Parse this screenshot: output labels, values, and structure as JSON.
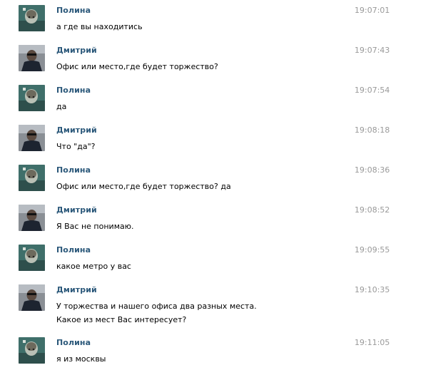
{
  "messages": [
    {
      "author": "Полина",
      "time": "19:07:01",
      "avatar": "polina",
      "lines": [
        "а где вы находитись"
      ]
    },
    {
      "author": "Дмитрий",
      "time": "19:07:43",
      "avatar": "dmitriy",
      "lines": [
        "Офис или место,где будет торжество?"
      ]
    },
    {
      "author": "Полина",
      "time": "19:07:54",
      "avatar": "polina",
      "lines": [
        "да"
      ]
    },
    {
      "author": "Дмитрий",
      "time": "19:08:18",
      "avatar": "dmitriy",
      "lines": [
        "Что \"да\"?"
      ]
    },
    {
      "author": "Полина",
      "time": "19:08:36",
      "avatar": "polina",
      "lines": [
        "Офис или место,где будет торжество? да"
      ]
    },
    {
      "author": "Дмитрий",
      "time": "19:08:52",
      "avatar": "dmitriy",
      "lines": [
        "Я Вас не понимаю."
      ]
    },
    {
      "author": "Полина",
      "time": "19:09:55",
      "avatar": "polina",
      "lines": [
        "какое метро у вас"
      ]
    },
    {
      "author": "Дмитрий",
      "time": "19:10:35",
      "avatar": "dmitriy",
      "lines": [
        "У торжества и нашего офиса два разных места.",
        "Какое из мест Вас интересует?"
      ]
    },
    {
      "author": "Полина",
      "time": "19:11:05",
      "avatar": "polina",
      "lines": [
        "я из москвы"
      ]
    }
  ],
  "colors": {
    "author": "#2b587a",
    "time": "#999999",
    "text": "#000000",
    "background": "#ffffff"
  },
  "icons": {
    "polina": "avatar-polina-icon",
    "dmitriy": "avatar-dmitriy-icon"
  }
}
